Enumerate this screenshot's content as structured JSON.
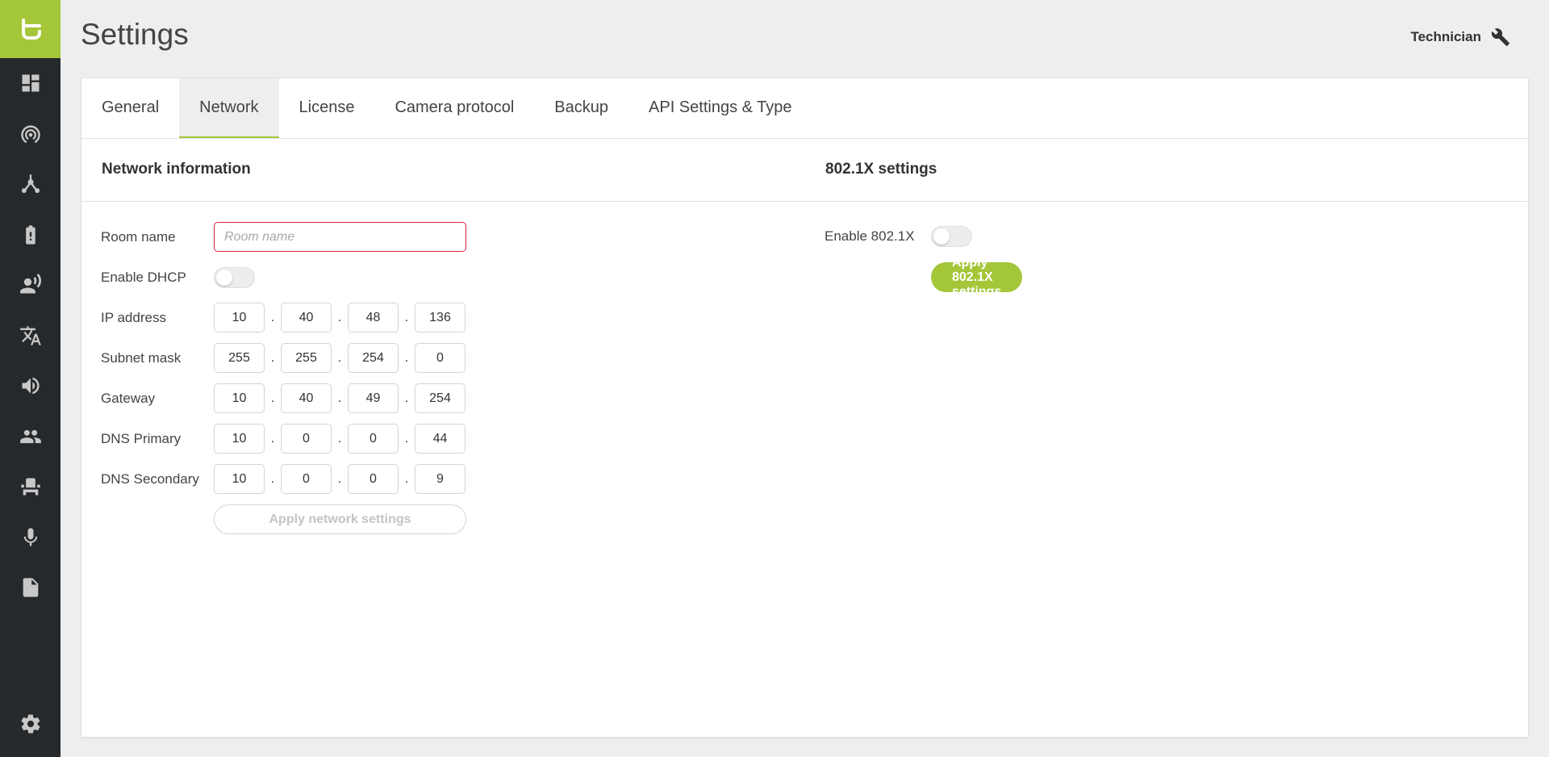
{
  "header": {
    "title": "Settings",
    "user_label": "Technician",
    "user_icon": "wrench-icon"
  },
  "sidebar": {
    "logo_icon": "brand-logo-icon",
    "items": [
      {
        "icon": "dashboard-icon"
      },
      {
        "icon": "broadcast-icon"
      },
      {
        "icon": "network-hub-icon"
      },
      {
        "icon": "battery-alert-icon"
      },
      {
        "icon": "speaker-person-icon"
      },
      {
        "icon": "translate-icon"
      },
      {
        "icon": "volume-icon"
      },
      {
        "icon": "people-icon"
      },
      {
        "icon": "seat-icon"
      },
      {
        "icon": "microphone-icon"
      },
      {
        "icon": "document-icon"
      }
    ],
    "bottom_icon": "gear-icon"
  },
  "tabs": [
    {
      "label": "General"
    },
    {
      "label": "Network",
      "active": true
    },
    {
      "label": "License"
    },
    {
      "label": "Camera protocol"
    },
    {
      "label": "Backup"
    },
    {
      "label": "API Settings & Type"
    }
  ],
  "network": {
    "title": "Network information",
    "room_name_label": "Room name",
    "room_name_placeholder": "Room name",
    "room_name_value": "",
    "dhcp_label": "Enable DHCP",
    "dhcp_enabled": false,
    "ip_label": "IP address",
    "ip": [
      "10",
      "40",
      "48",
      "136"
    ],
    "subnet_label": "Subnet mask",
    "subnet": [
      "255",
      "255",
      "254",
      "0"
    ],
    "gateway_label": "Gateway",
    "gateway": [
      "10",
      "40",
      "49",
      "254"
    ],
    "dns1_label": "DNS Primary",
    "dns1": [
      "10",
      "0",
      "0",
      "44"
    ],
    "dns2_label": "DNS Secondary",
    "dns2": [
      "10",
      "0",
      "0",
      "9"
    ],
    "apply_label": "Apply network settings"
  },
  "dot1x": {
    "title": "802.1X settings",
    "enable_label": "Enable 802.1X",
    "enabled": false,
    "apply_label": "Apply 802.1X settings"
  },
  "colors": {
    "accent": "#a4c639",
    "sidebar": "#26292c",
    "error": "#d9263a"
  }
}
